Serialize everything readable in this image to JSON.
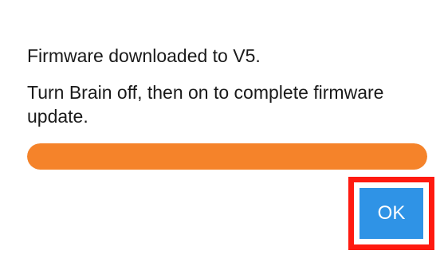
{
  "dialog": {
    "message": "Firmware downloaded to V5.",
    "instruction": "Turn Brain off, then on to complete firmware update.",
    "progress_percent": 100,
    "ok_label": "OK"
  },
  "colors": {
    "progress": "#f5832a",
    "button": "#2f93e6",
    "highlight": "#ff1a10"
  }
}
